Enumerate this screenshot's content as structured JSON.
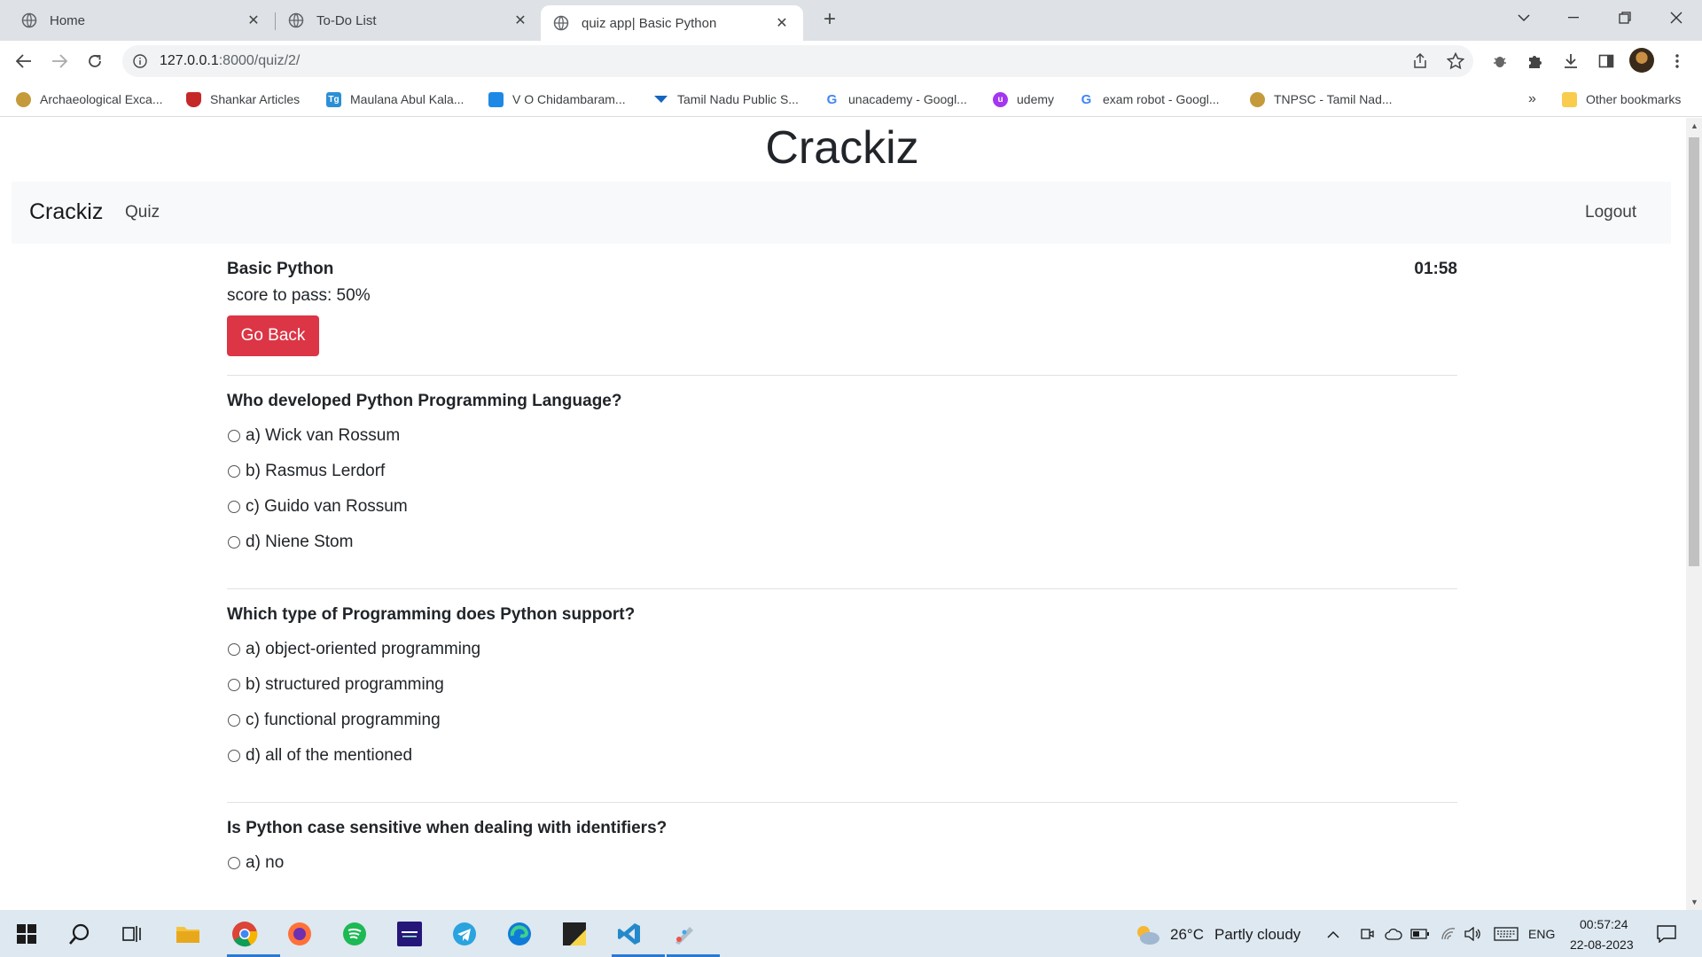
{
  "browser": {
    "tabs": [
      {
        "title": "Home",
        "active": false
      },
      {
        "title": "To-Do List",
        "active": false
      },
      {
        "title": "quiz app| Basic Python",
        "active": true
      }
    ],
    "url_host": "127.0.0.1",
    "url_path": ":8000/quiz/2/",
    "bookmarks": [
      {
        "label": "Archaeological Exca...",
        "icon": "archaeology-icon",
        "color": "#c59a3a"
      },
      {
        "label": "Shankar Articles",
        "icon": "shield-icon",
        "color": "#c62828"
      },
      {
        "label": "Maulana Abul Kala...",
        "icon": "tg-icon",
        "color": "#2b8fd6"
      },
      {
        "label": "V O Chidambaram...",
        "icon": "portal-icon",
        "color": "#1e88e5"
      },
      {
        "label": "Tamil Nadu Public S...",
        "icon": "tn-icon",
        "color": "#1565c0"
      },
      {
        "label": "unacademy - Googl...",
        "icon": "google-icon",
        "color": "#4285f4"
      },
      {
        "label": "udemy",
        "icon": "udemy-icon",
        "color": "#a435f0"
      },
      {
        "label": "exam robot - Googl...",
        "icon": "google-icon",
        "color": "#4285f4"
      },
      {
        "label": "TNPSC - Tamil Nad...",
        "icon": "tnpsc-icon",
        "color": "#c59a3a"
      }
    ],
    "more_bookmarks": "»",
    "other_bookmarks": "Other bookmarks"
  },
  "page": {
    "site_title": "Crackiz",
    "navbar": {
      "brand": "Crackiz",
      "quiz_link": "Quiz",
      "logout_link": "Logout"
    },
    "quiz": {
      "name": "Basic Python",
      "score_to_pass": "score to pass: 50%",
      "timer": "01:58",
      "go_back": "Go Back"
    },
    "questions": [
      {
        "text": "Who developed Python Programming Language?",
        "options": [
          "a) Wick van Rossum",
          "b) Rasmus Lerdorf",
          "c) Guido van Rossum",
          "d) Niene Stom"
        ]
      },
      {
        "text": "Which type of Programming does Python support?",
        "options": [
          "a) object-oriented programming",
          "b) structured programming",
          "c) functional programming",
          "d) all of the mentioned"
        ]
      },
      {
        "text": "Is Python case sensitive when dealing with identifiers?",
        "options": [
          "a) no"
        ]
      }
    ]
  },
  "taskbar": {
    "weather": "26°C",
    "weather_desc": "Partly cloudy",
    "lang": "ENG",
    "time": "00:57:24",
    "date": "22-08-2023"
  },
  "colors": {
    "danger": "#dc3545",
    "navbar_bg": "#f8f9fa",
    "taskbar_bg": "#dde8f1"
  }
}
